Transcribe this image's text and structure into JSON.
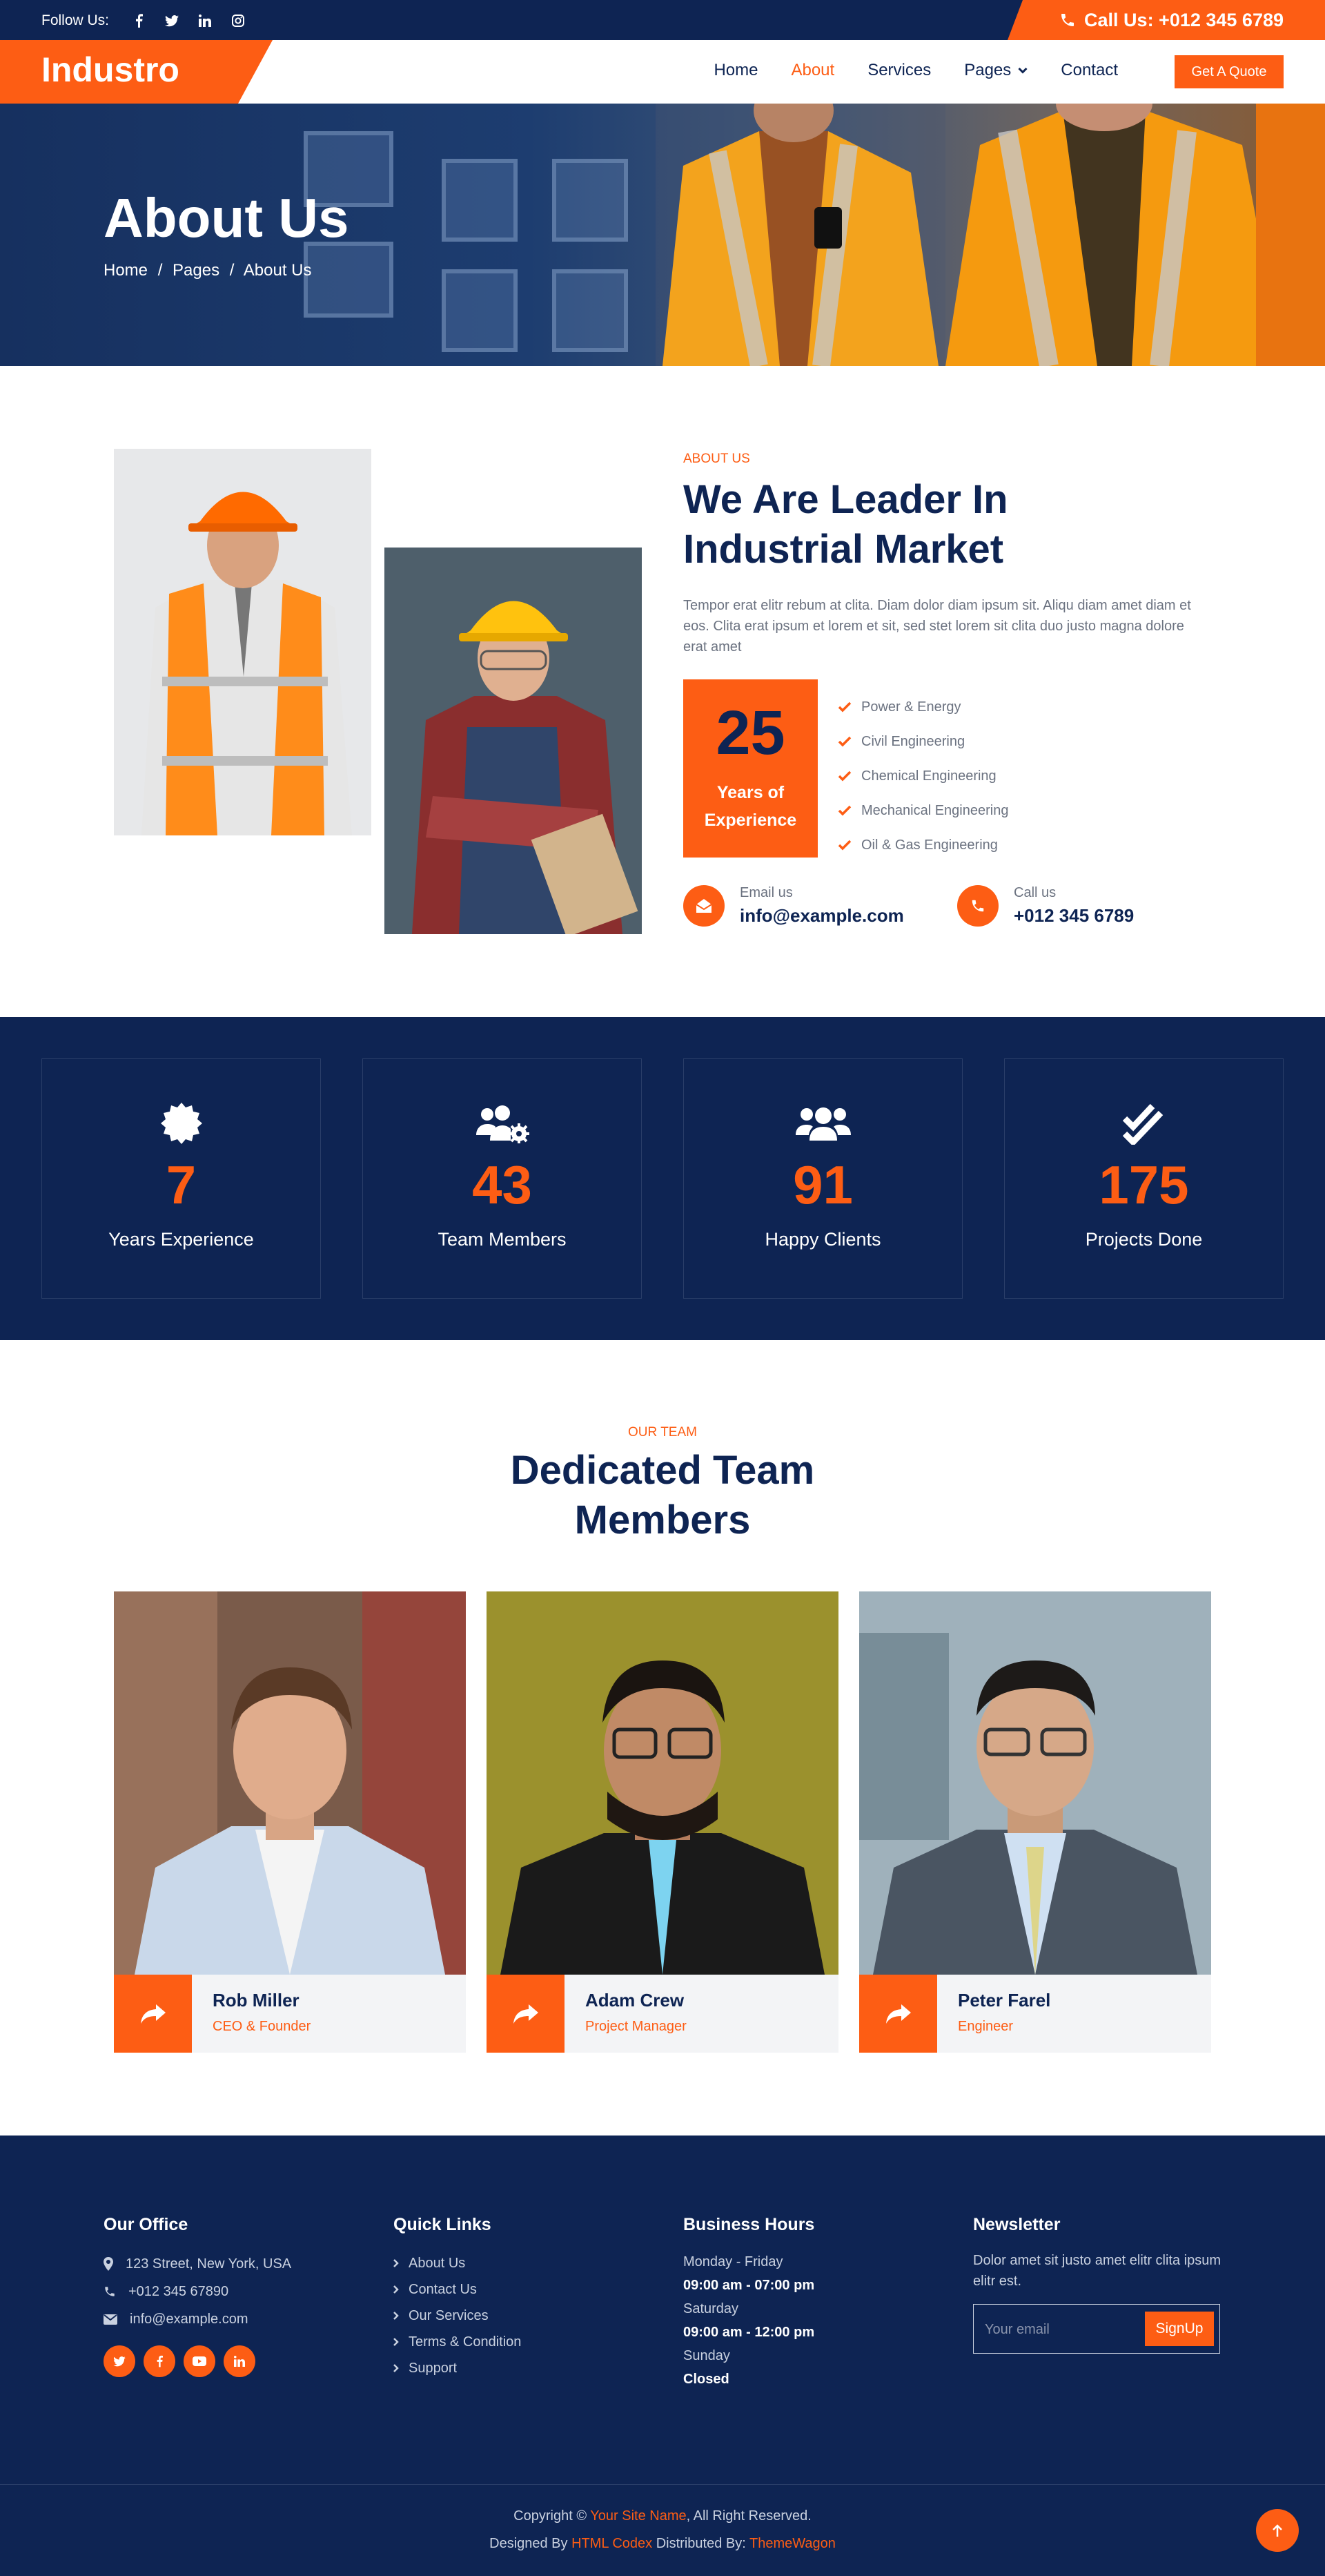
{
  "topbar": {
    "follow_label": "Follow Us:",
    "social": [
      "facebook-icon",
      "twitter-icon",
      "linkedin-icon",
      "instagram-icon"
    ],
    "call_label": "Call Us: +012 345 6789"
  },
  "nav": {
    "brand": "Industro",
    "items": [
      {
        "label": "Home"
      },
      {
        "label": "About",
        "active": true
      },
      {
        "label": "Services"
      },
      {
        "label": "Pages",
        "dropdown": true
      },
      {
        "label": "Contact"
      }
    ],
    "cta": "Get A Quote"
  },
  "hero": {
    "title": "About Us",
    "breadcrumb": [
      "Home",
      "Pages",
      "About Us"
    ],
    "separator": "/"
  },
  "about": {
    "tag": "ABOUT US",
    "heading_line1": "We Are Leader In",
    "heading_line2": "Industrial Market",
    "text": "Tempor erat elitr rebum at clita. Diam dolor diam ipsum sit. Aliqu diam amet diam et eos. Clita erat ipsum et lorem et sit, sed stet lorem sit clita duo justo magna dolore erat amet",
    "experience_number": "25",
    "experience_line1": "Years of",
    "experience_line2": "Experience",
    "features": [
      "Power & Energy",
      "Civil Engineering",
      "Chemical Engineering",
      "Mechanical Engineering",
      "Oil & Gas Engineering"
    ],
    "email_label": "Email us",
    "email_value": "info@example.com",
    "call_label": "Call us",
    "call_value": "+012 345 6789"
  },
  "stats": [
    {
      "icon": "certificate-icon",
      "value": "7",
      "label": "Years Experience"
    },
    {
      "icon": "users-cog-icon",
      "value": "43",
      "label": "Team Members"
    },
    {
      "icon": "users-icon",
      "value": "91",
      "label": "Happy Clients"
    },
    {
      "icon": "check-double-icon",
      "value": "175",
      "label": "Projects Done"
    }
  ],
  "team": {
    "tag": "OUR TEAM",
    "heading_line1": "Dedicated Team",
    "heading_line2": "Members",
    "members": [
      {
        "name": "Rob Miller",
        "role": "CEO & Founder"
      },
      {
        "name": "Adam Crew",
        "role": "Project Manager"
      },
      {
        "name": "Peter Farel",
        "role": "Engineer"
      }
    ]
  },
  "footer": {
    "office": {
      "title": "Our Office",
      "address": "123 Street, New York, USA",
      "phone": "+012 345 67890",
      "email": "info@example.com",
      "social": [
        "twitter-icon",
        "facebook-icon",
        "youtube-icon",
        "linkedin-icon"
      ]
    },
    "links": {
      "title": "Quick Links",
      "items": [
        "About Us",
        "Contact Us",
        "Our Services",
        "Terms & Condition",
        "Support"
      ]
    },
    "hours": {
      "title": "Business Hours",
      "rows": [
        {
          "day": "Monday - Friday",
          "time": "09:00 am - 07:00 pm"
        },
        {
          "day": "Saturday",
          "time": "09:00 am - 12:00 pm"
        },
        {
          "day": "Sunday",
          "time": "Closed"
        }
      ]
    },
    "newsletter": {
      "title": "Newsletter",
      "text": "Dolor amet sit justo amet elitr clita ipsum elitr est.",
      "placeholder": "Your email",
      "button": "SignUp"
    },
    "copyright": {
      "prefix": "Copyright ©",
      "site": "Your Site Name",
      "suffix": ", All Right Reserved.",
      "designed_prefix": "Designed By",
      "designer": "HTML Codex",
      "distributed_prefix": "Distributed By:",
      "distributor": "ThemeWagon"
    }
  },
  "colors": {
    "navy": "#0e2453",
    "orange": "#fd5d14"
  }
}
